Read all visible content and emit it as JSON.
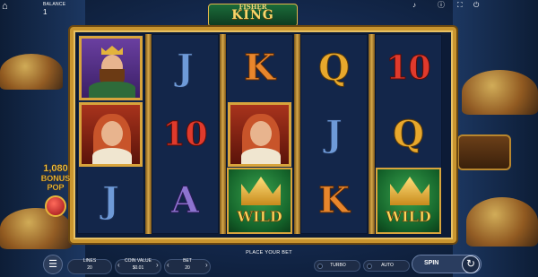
{
  "topbar": {
    "home_icon": "⌂",
    "balance_label": "BALANCE",
    "balance_value": "1"
  },
  "logo": {
    "line1": "FISHER",
    "line2": "KING"
  },
  "reels": [
    [
      "king",
      "queen",
      "J-blue"
    ],
    [
      "J-blue",
      "10",
      "A"
    ],
    [
      "K",
      "queen",
      "WILD"
    ],
    [
      "Q",
      "J-blue",
      "K"
    ],
    [
      "10",
      "Q",
      "WILD"
    ]
  ],
  "symbols": {
    "J": "J",
    "K": "K",
    "Q": "Q",
    "A": "A",
    "TEN": "10",
    "WILD": "WILD"
  },
  "bonus_pop": {
    "count": "1,080",
    "label_line1": "BONUS",
    "label_line2": "POP"
  },
  "message": "PLACE YOUR BET",
  "controls": {
    "lines_label": "LINES",
    "lines_value": "20",
    "coin_value_label": "COIN VALUE",
    "coin_value_value": "$0.01",
    "bet_label": "BET",
    "bet_value": "20",
    "turbo_label": "TURBO",
    "auto_label": "AUTO",
    "spin_label": "SPIN"
  },
  "colors": {
    "frame_gold": "#c9952f",
    "reel_bg": "#13264a",
    "wild_green": "#14632a"
  }
}
